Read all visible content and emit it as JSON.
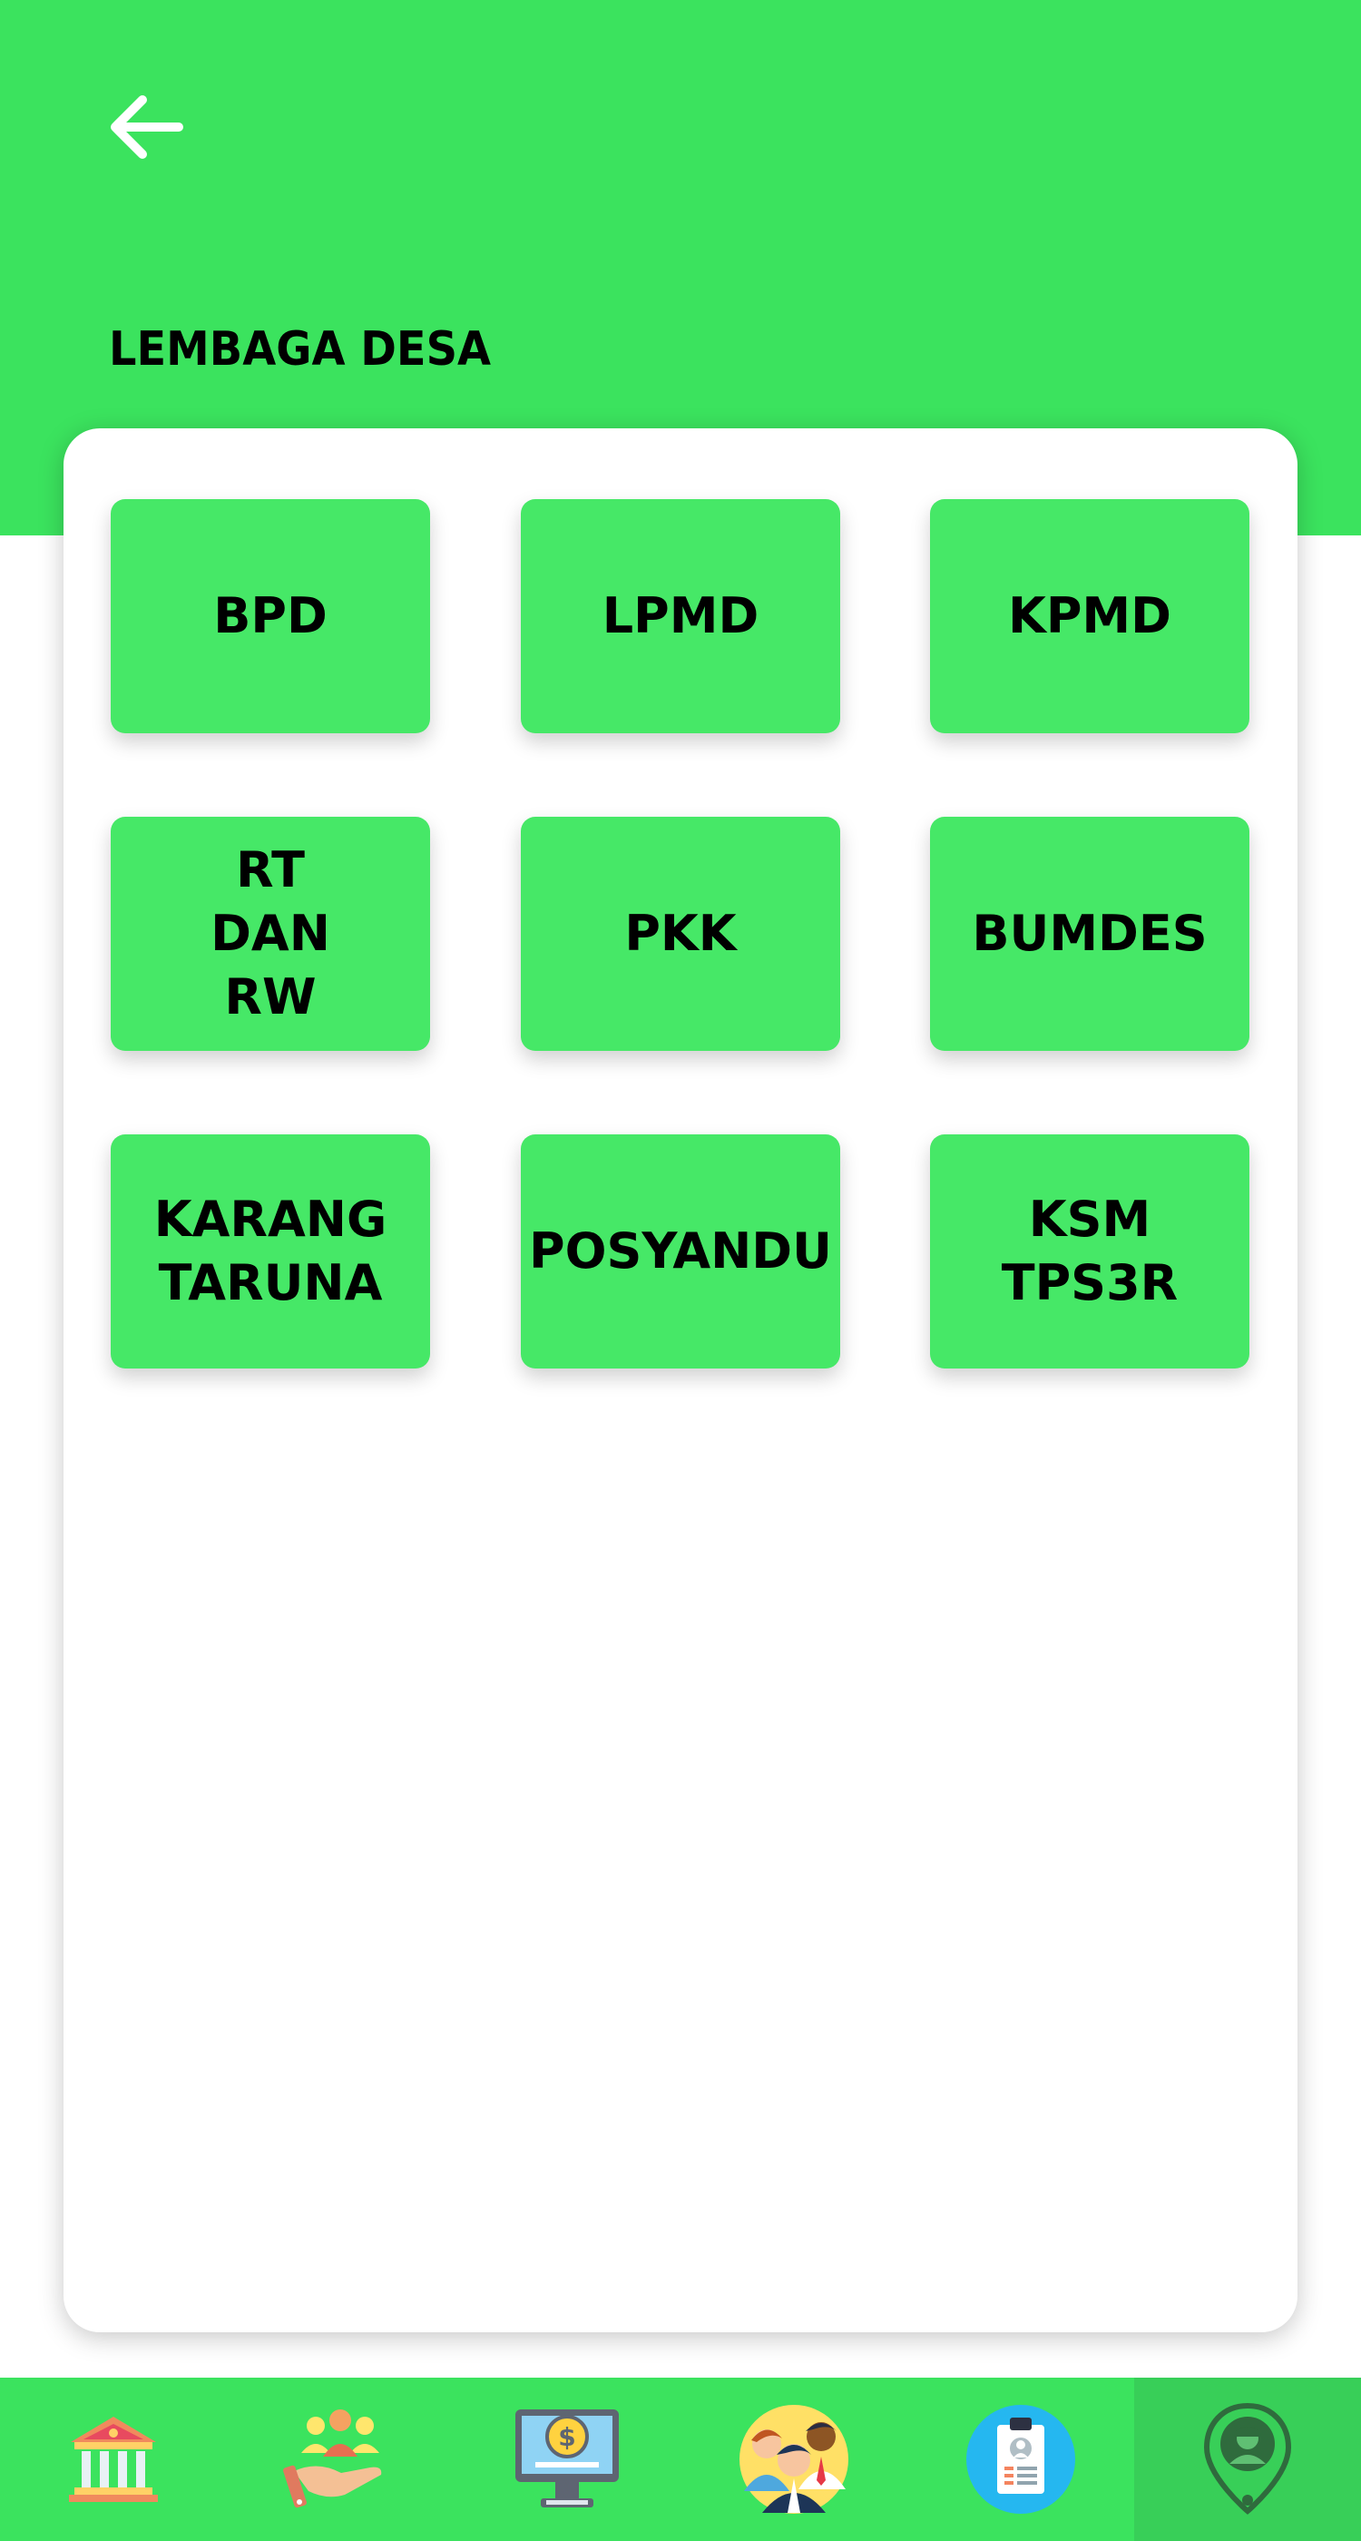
{
  "header": {
    "title": "LEMBAGA DESA",
    "back_icon": "arrow-left-icon",
    "color": "#3be35e"
  },
  "tiles": [
    {
      "label": "BPD"
    },
    {
      "label": "LPMD"
    },
    {
      "label": "KPMD"
    },
    {
      "label": "RT\nDAN\nRW"
    },
    {
      "label": "PKK"
    },
    {
      "label": "BUMDES"
    },
    {
      "label": "KARANG\nTARUNA"
    },
    {
      "label": "POSYANDU"
    },
    {
      "label": "KSM\nTPS3R"
    }
  ],
  "tile_color": "#46e867",
  "bottom_nav": {
    "items": [
      {
        "icon": "government-building-icon"
      },
      {
        "icon": "community-hand-icon"
      },
      {
        "icon": "computer-money-icon"
      },
      {
        "icon": "people-group-icon"
      },
      {
        "icon": "id-clipboard-icon"
      },
      {
        "icon": "location-person-icon",
        "active": true
      }
    ]
  }
}
